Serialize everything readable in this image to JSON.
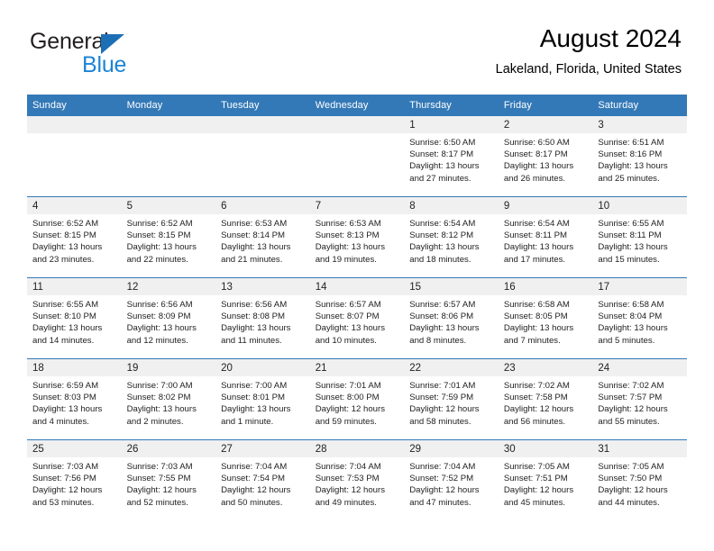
{
  "brand": {
    "name_part1": "General",
    "name_part2": "Blue",
    "triangle_color": "#1c6fb5",
    "blue_color": "#1c84d6"
  },
  "header": {
    "title": "August 2024",
    "subtitle": "Lakeland, Florida, United States"
  },
  "theme": {
    "header_bg": "#3479b7",
    "daynum_bg": "#f0f0f0",
    "row_divider": "#3479b7"
  },
  "weekdays": [
    "Sunday",
    "Monday",
    "Tuesday",
    "Wednesday",
    "Thursday",
    "Friday",
    "Saturday"
  ],
  "labels": {
    "sunrise_prefix": "Sunrise:",
    "sunset_prefix": "Sunset:",
    "daylight_prefix": "Daylight:"
  },
  "weeks": [
    [
      {
        "day": "",
        "sunrise": "",
        "sunset": "",
        "daylight": ""
      },
      {
        "day": "",
        "sunrise": "",
        "sunset": "",
        "daylight": ""
      },
      {
        "day": "",
        "sunrise": "",
        "sunset": "",
        "daylight": ""
      },
      {
        "day": "",
        "sunrise": "",
        "sunset": "",
        "daylight": ""
      },
      {
        "day": "1",
        "sunrise": "Sunrise: 6:50 AM",
        "sunset": "Sunset: 8:17 PM",
        "daylight": "Daylight: 13 hours and 27 minutes."
      },
      {
        "day": "2",
        "sunrise": "Sunrise: 6:50 AM",
        "sunset": "Sunset: 8:17 PM",
        "daylight": "Daylight: 13 hours and 26 minutes."
      },
      {
        "day": "3",
        "sunrise": "Sunrise: 6:51 AM",
        "sunset": "Sunset: 8:16 PM",
        "daylight": "Daylight: 13 hours and 25 minutes."
      }
    ],
    [
      {
        "day": "4",
        "sunrise": "Sunrise: 6:52 AM",
        "sunset": "Sunset: 8:15 PM",
        "daylight": "Daylight: 13 hours and 23 minutes."
      },
      {
        "day": "5",
        "sunrise": "Sunrise: 6:52 AM",
        "sunset": "Sunset: 8:15 PM",
        "daylight": "Daylight: 13 hours and 22 minutes."
      },
      {
        "day": "6",
        "sunrise": "Sunrise: 6:53 AM",
        "sunset": "Sunset: 8:14 PM",
        "daylight": "Daylight: 13 hours and 21 minutes."
      },
      {
        "day": "7",
        "sunrise": "Sunrise: 6:53 AM",
        "sunset": "Sunset: 8:13 PM",
        "daylight": "Daylight: 13 hours and 19 minutes."
      },
      {
        "day": "8",
        "sunrise": "Sunrise: 6:54 AM",
        "sunset": "Sunset: 8:12 PM",
        "daylight": "Daylight: 13 hours and 18 minutes."
      },
      {
        "day": "9",
        "sunrise": "Sunrise: 6:54 AM",
        "sunset": "Sunset: 8:11 PM",
        "daylight": "Daylight: 13 hours and 17 minutes."
      },
      {
        "day": "10",
        "sunrise": "Sunrise: 6:55 AM",
        "sunset": "Sunset: 8:11 PM",
        "daylight": "Daylight: 13 hours and 15 minutes."
      }
    ],
    [
      {
        "day": "11",
        "sunrise": "Sunrise: 6:55 AM",
        "sunset": "Sunset: 8:10 PM",
        "daylight": "Daylight: 13 hours and 14 minutes."
      },
      {
        "day": "12",
        "sunrise": "Sunrise: 6:56 AM",
        "sunset": "Sunset: 8:09 PM",
        "daylight": "Daylight: 13 hours and 12 minutes."
      },
      {
        "day": "13",
        "sunrise": "Sunrise: 6:56 AM",
        "sunset": "Sunset: 8:08 PM",
        "daylight": "Daylight: 13 hours and 11 minutes."
      },
      {
        "day": "14",
        "sunrise": "Sunrise: 6:57 AM",
        "sunset": "Sunset: 8:07 PM",
        "daylight": "Daylight: 13 hours and 10 minutes."
      },
      {
        "day": "15",
        "sunrise": "Sunrise: 6:57 AM",
        "sunset": "Sunset: 8:06 PM",
        "daylight": "Daylight: 13 hours and 8 minutes."
      },
      {
        "day": "16",
        "sunrise": "Sunrise: 6:58 AM",
        "sunset": "Sunset: 8:05 PM",
        "daylight": "Daylight: 13 hours and 7 minutes."
      },
      {
        "day": "17",
        "sunrise": "Sunrise: 6:58 AM",
        "sunset": "Sunset: 8:04 PM",
        "daylight": "Daylight: 13 hours and 5 minutes."
      }
    ],
    [
      {
        "day": "18",
        "sunrise": "Sunrise: 6:59 AM",
        "sunset": "Sunset: 8:03 PM",
        "daylight": "Daylight: 13 hours and 4 minutes."
      },
      {
        "day": "19",
        "sunrise": "Sunrise: 7:00 AM",
        "sunset": "Sunset: 8:02 PM",
        "daylight": "Daylight: 13 hours and 2 minutes."
      },
      {
        "day": "20",
        "sunrise": "Sunrise: 7:00 AM",
        "sunset": "Sunset: 8:01 PM",
        "daylight": "Daylight: 13 hours and 1 minute."
      },
      {
        "day": "21",
        "sunrise": "Sunrise: 7:01 AM",
        "sunset": "Sunset: 8:00 PM",
        "daylight": "Daylight: 12 hours and 59 minutes."
      },
      {
        "day": "22",
        "sunrise": "Sunrise: 7:01 AM",
        "sunset": "Sunset: 7:59 PM",
        "daylight": "Daylight: 12 hours and 58 minutes."
      },
      {
        "day": "23",
        "sunrise": "Sunrise: 7:02 AM",
        "sunset": "Sunset: 7:58 PM",
        "daylight": "Daylight: 12 hours and 56 minutes."
      },
      {
        "day": "24",
        "sunrise": "Sunrise: 7:02 AM",
        "sunset": "Sunset: 7:57 PM",
        "daylight": "Daylight: 12 hours and 55 minutes."
      }
    ],
    [
      {
        "day": "25",
        "sunrise": "Sunrise: 7:03 AM",
        "sunset": "Sunset: 7:56 PM",
        "daylight": "Daylight: 12 hours and 53 minutes."
      },
      {
        "day": "26",
        "sunrise": "Sunrise: 7:03 AM",
        "sunset": "Sunset: 7:55 PM",
        "daylight": "Daylight: 12 hours and 52 minutes."
      },
      {
        "day": "27",
        "sunrise": "Sunrise: 7:04 AM",
        "sunset": "Sunset: 7:54 PM",
        "daylight": "Daylight: 12 hours and 50 minutes."
      },
      {
        "day": "28",
        "sunrise": "Sunrise: 7:04 AM",
        "sunset": "Sunset: 7:53 PM",
        "daylight": "Daylight: 12 hours and 49 minutes."
      },
      {
        "day": "29",
        "sunrise": "Sunrise: 7:04 AM",
        "sunset": "Sunset: 7:52 PM",
        "daylight": "Daylight: 12 hours and 47 minutes."
      },
      {
        "day": "30",
        "sunrise": "Sunrise: 7:05 AM",
        "sunset": "Sunset: 7:51 PM",
        "daylight": "Daylight: 12 hours and 45 minutes."
      },
      {
        "day": "31",
        "sunrise": "Sunrise: 7:05 AM",
        "sunset": "Sunset: 7:50 PM",
        "daylight": "Daylight: 12 hours and 44 minutes."
      }
    ]
  ]
}
